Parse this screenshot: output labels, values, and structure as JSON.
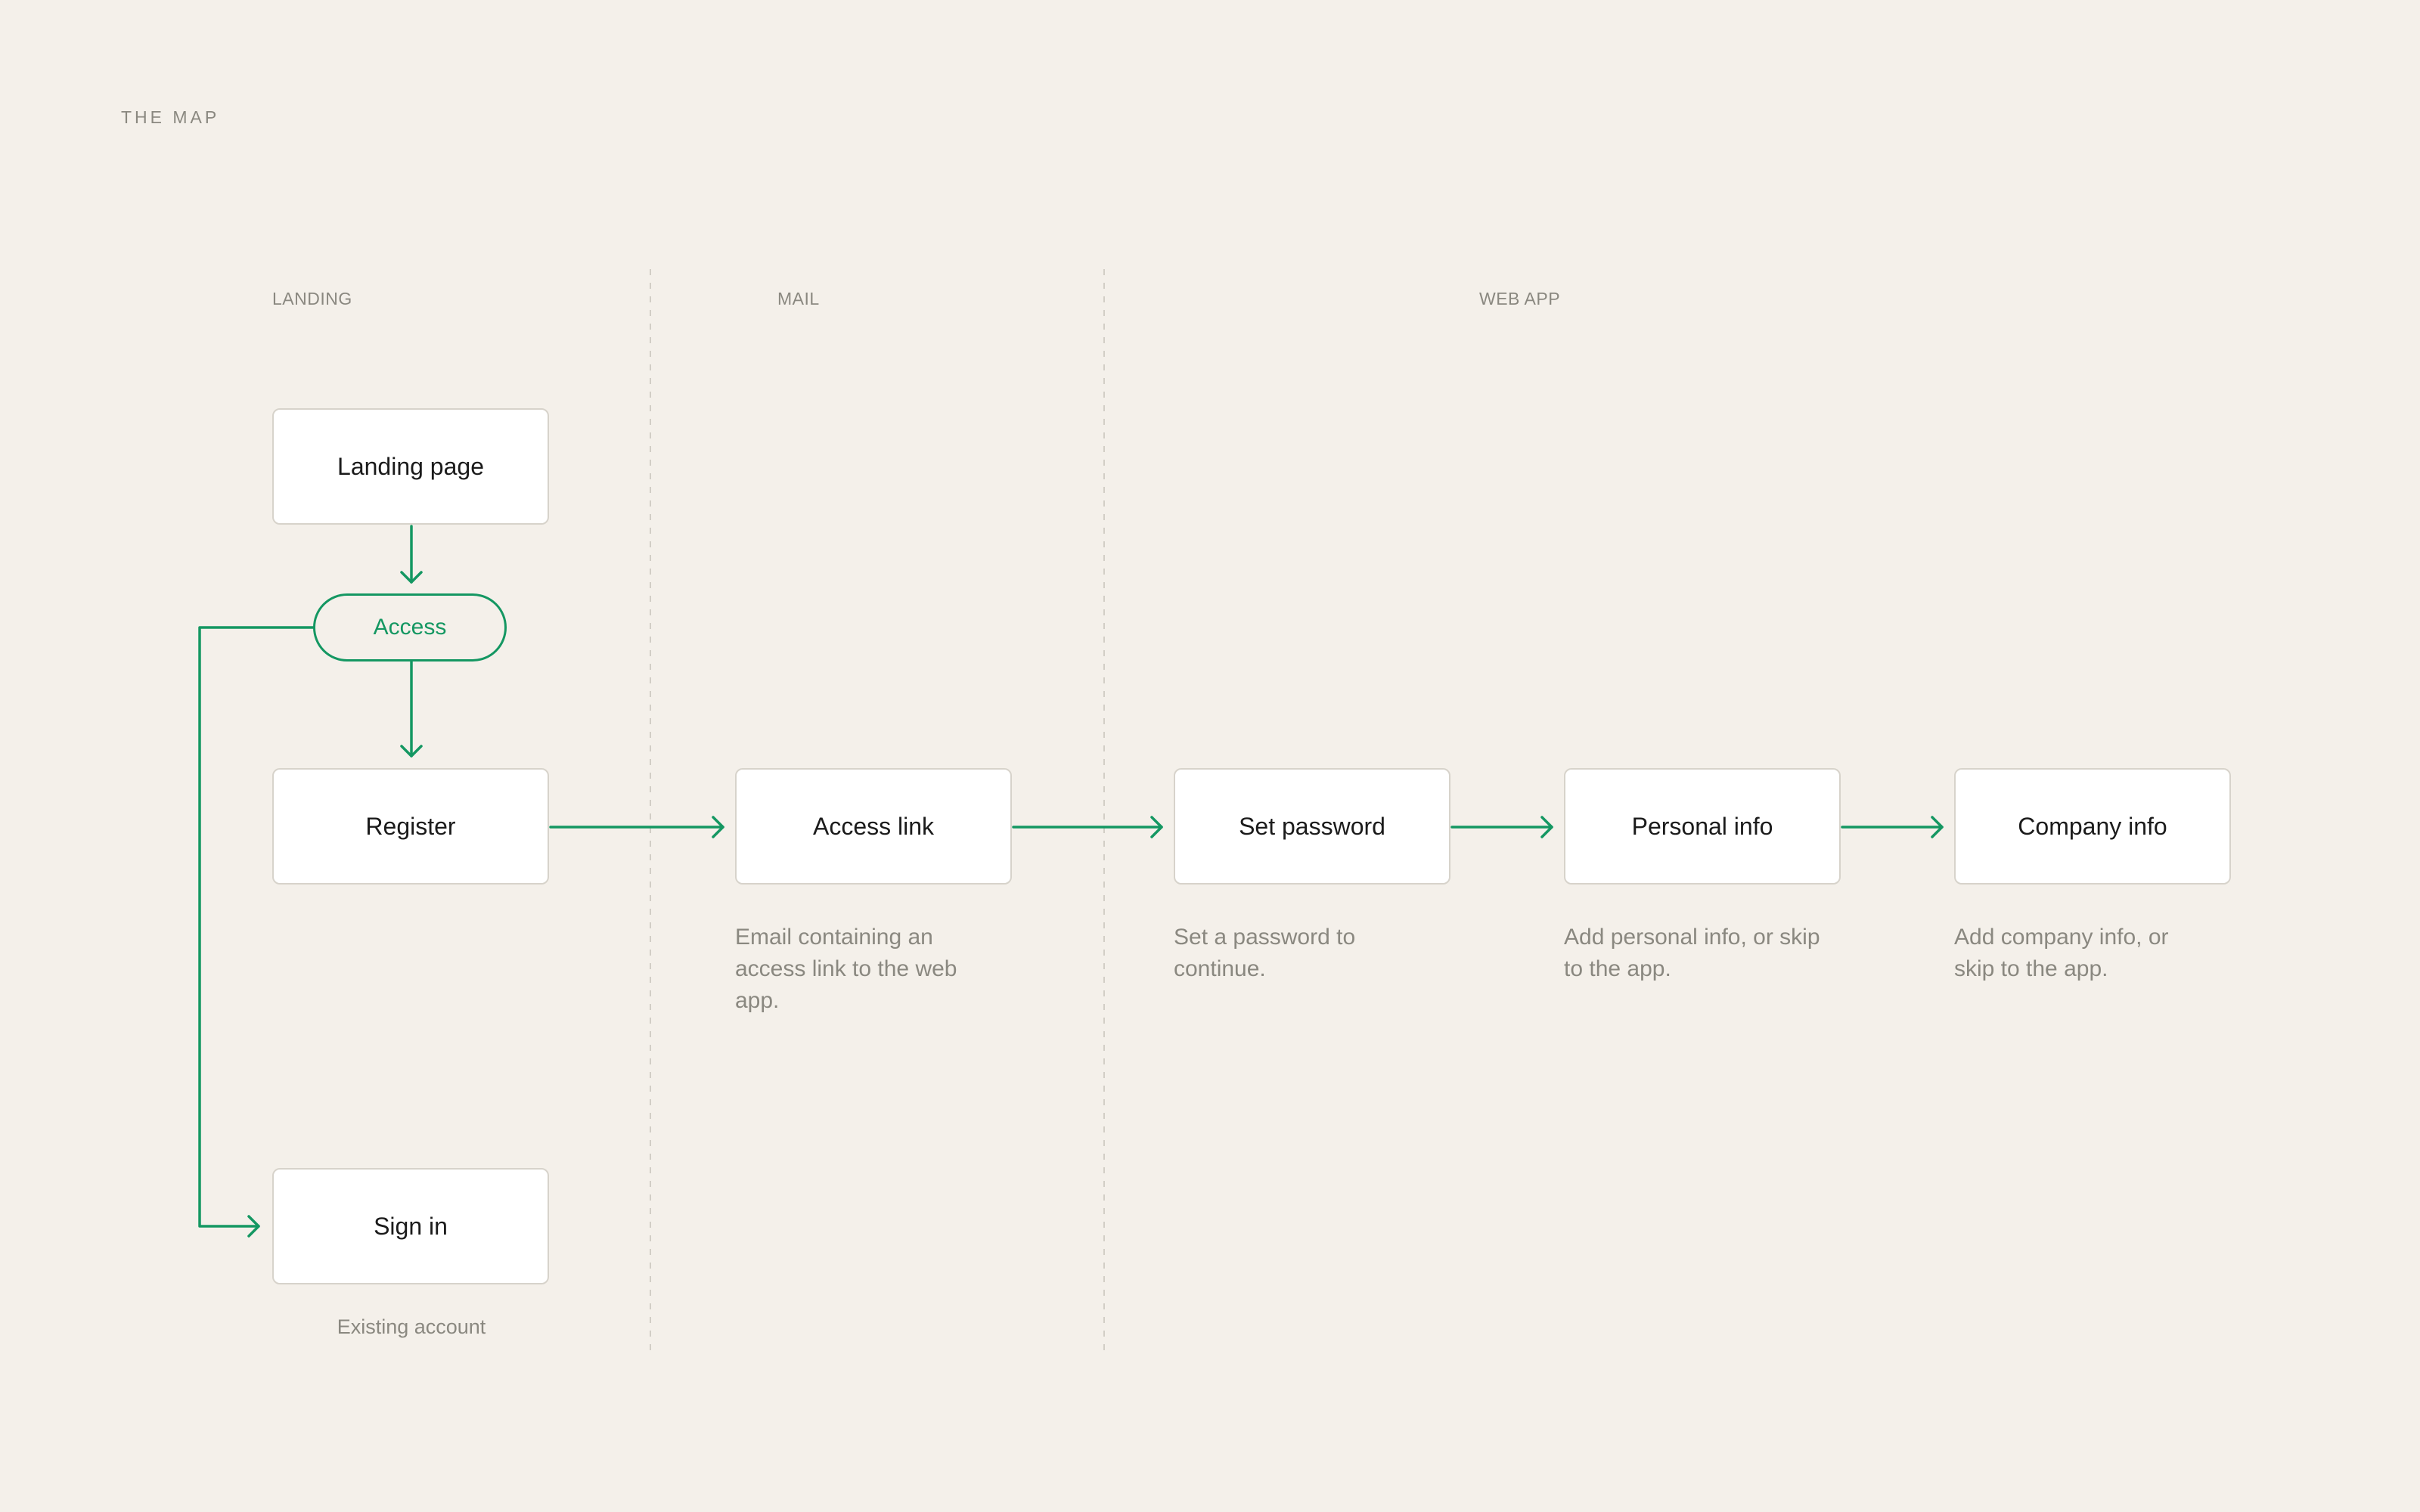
{
  "header": {
    "title": "THE MAP"
  },
  "lanes": [
    {
      "label": "LANDING"
    },
    {
      "label": "MAIL"
    },
    {
      "label": "WEB APP"
    }
  ],
  "nodes": {
    "landing_page": "Landing page",
    "access": "Access",
    "register": "Register",
    "sign_in": "Sign in",
    "access_link": "Access link",
    "set_password": "Set password",
    "personal_info": "Personal info",
    "company_info": "Company info"
  },
  "descriptions": {
    "sign_in": "Existing account",
    "access_link": "Email containing an access link to the web app.",
    "set_password": "Set a password to continue.",
    "personal_info": "Add personal info, or skip to the app.",
    "company_info": "Add company info, or skip to the app."
  },
  "colors": {
    "accent": "#149762",
    "background": "#f4f0ea",
    "muted_text": "#8a8880",
    "node_border": "#d7d3cb"
  }
}
